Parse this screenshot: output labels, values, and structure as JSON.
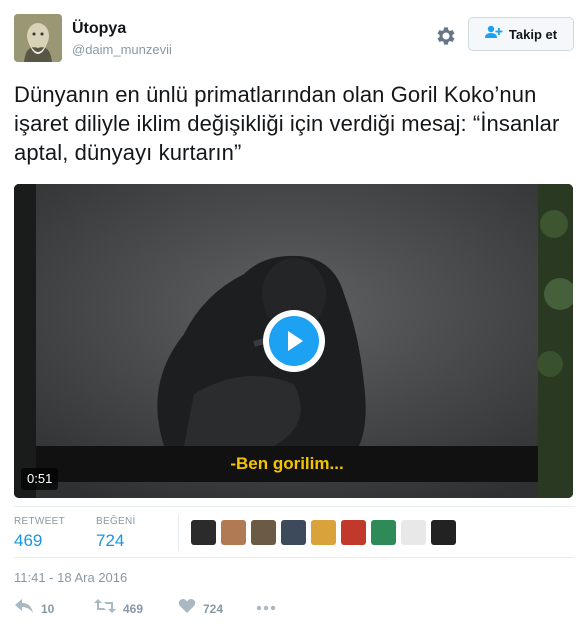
{
  "user": {
    "name": "Ütopya",
    "handle": "@daim_munzevii"
  },
  "header": {
    "follow_label": "Takip et",
    "settings_icon": "gear-icon",
    "follow_icon": "add-user-icon"
  },
  "tweet": {
    "text": "Dünyanın en ünlü primatlarından olan Goril Koko’nun işaret diliyle iklim değişikliği için verdiği mesaj: “İnsanlar aptal, dünyayı kurtarın”"
  },
  "video": {
    "subtitle": "-Ben gorilim...",
    "duration": "0:51",
    "play_icon": "play-icon"
  },
  "stats": {
    "retweets_label": "RETWEET",
    "retweets_value": "469",
    "likes_label": "BEĞENİ",
    "likes_value": "724"
  },
  "timestamp": "11:41 - 18 Ara 2016",
  "actions": {
    "reply_count": "10",
    "retweet_count": "469",
    "like_count": "724"
  },
  "colors": {
    "accent": "#1da1f2",
    "stat_blue": "#1b95e0",
    "muted": "#8899a6",
    "subtitle_yellow": "#f5c400"
  }
}
